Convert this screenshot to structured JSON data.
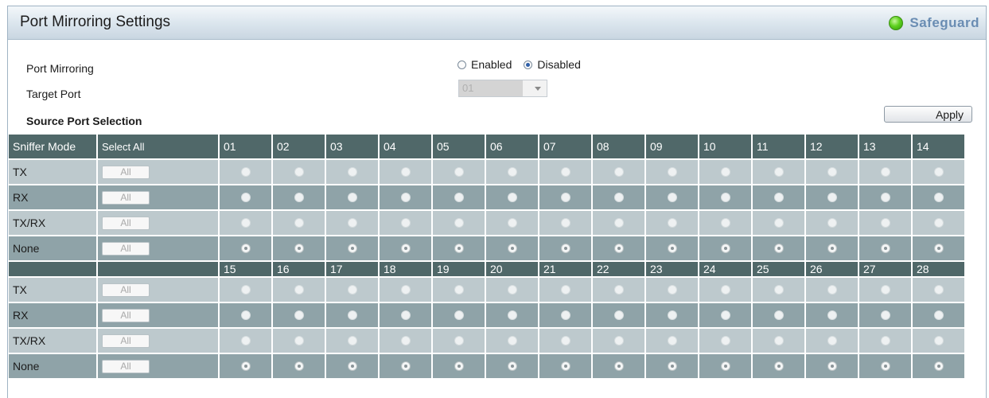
{
  "window": {
    "title": "Port Mirroring Settings",
    "safeguard_label": "Safeguard"
  },
  "settings": {
    "port_mirroring_label": "Port Mirroring",
    "enabled_label": "Enabled",
    "disabled_label": "Disabled",
    "selected_state": "Disabled",
    "target_port_label": "Target Port",
    "target_port_value": "01",
    "source_port_heading": "Source Port Selection",
    "apply_label": "Apply"
  },
  "table": {
    "sniffer_mode_header": "Sniffer Mode",
    "select_all_header": "Select All",
    "all_button_label": "All",
    "groups": [
      {
        "ports": [
          "01",
          "02",
          "03",
          "04",
          "05",
          "06",
          "07",
          "08",
          "09",
          "10",
          "11",
          "12",
          "13",
          "14"
        ],
        "rows": [
          {
            "mode": "TX",
            "selected": false
          },
          {
            "mode": "RX",
            "selected": false
          },
          {
            "mode": "TX/RX",
            "selected": false
          },
          {
            "mode": "None",
            "selected": true
          }
        ]
      },
      {
        "ports": [
          "15",
          "16",
          "17",
          "18",
          "19",
          "20",
          "21",
          "22",
          "23",
          "24",
          "25",
          "26",
          "27",
          "28"
        ],
        "rows": [
          {
            "mode": "TX",
            "selected": false
          },
          {
            "mode": "RX",
            "selected": false
          },
          {
            "mode": "TX/RX",
            "selected": false
          },
          {
            "mode": "None",
            "selected": true
          }
        ]
      }
    ]
  },
  "colors": {
    "header_bg": "#506869",
    "row_light": "#bdc9cd",
    "row_dark": "#8fa3a8",
    "safeguard_text": "#6a8db3",
    "safeguard_led": "#5fd11f"
  }
}
